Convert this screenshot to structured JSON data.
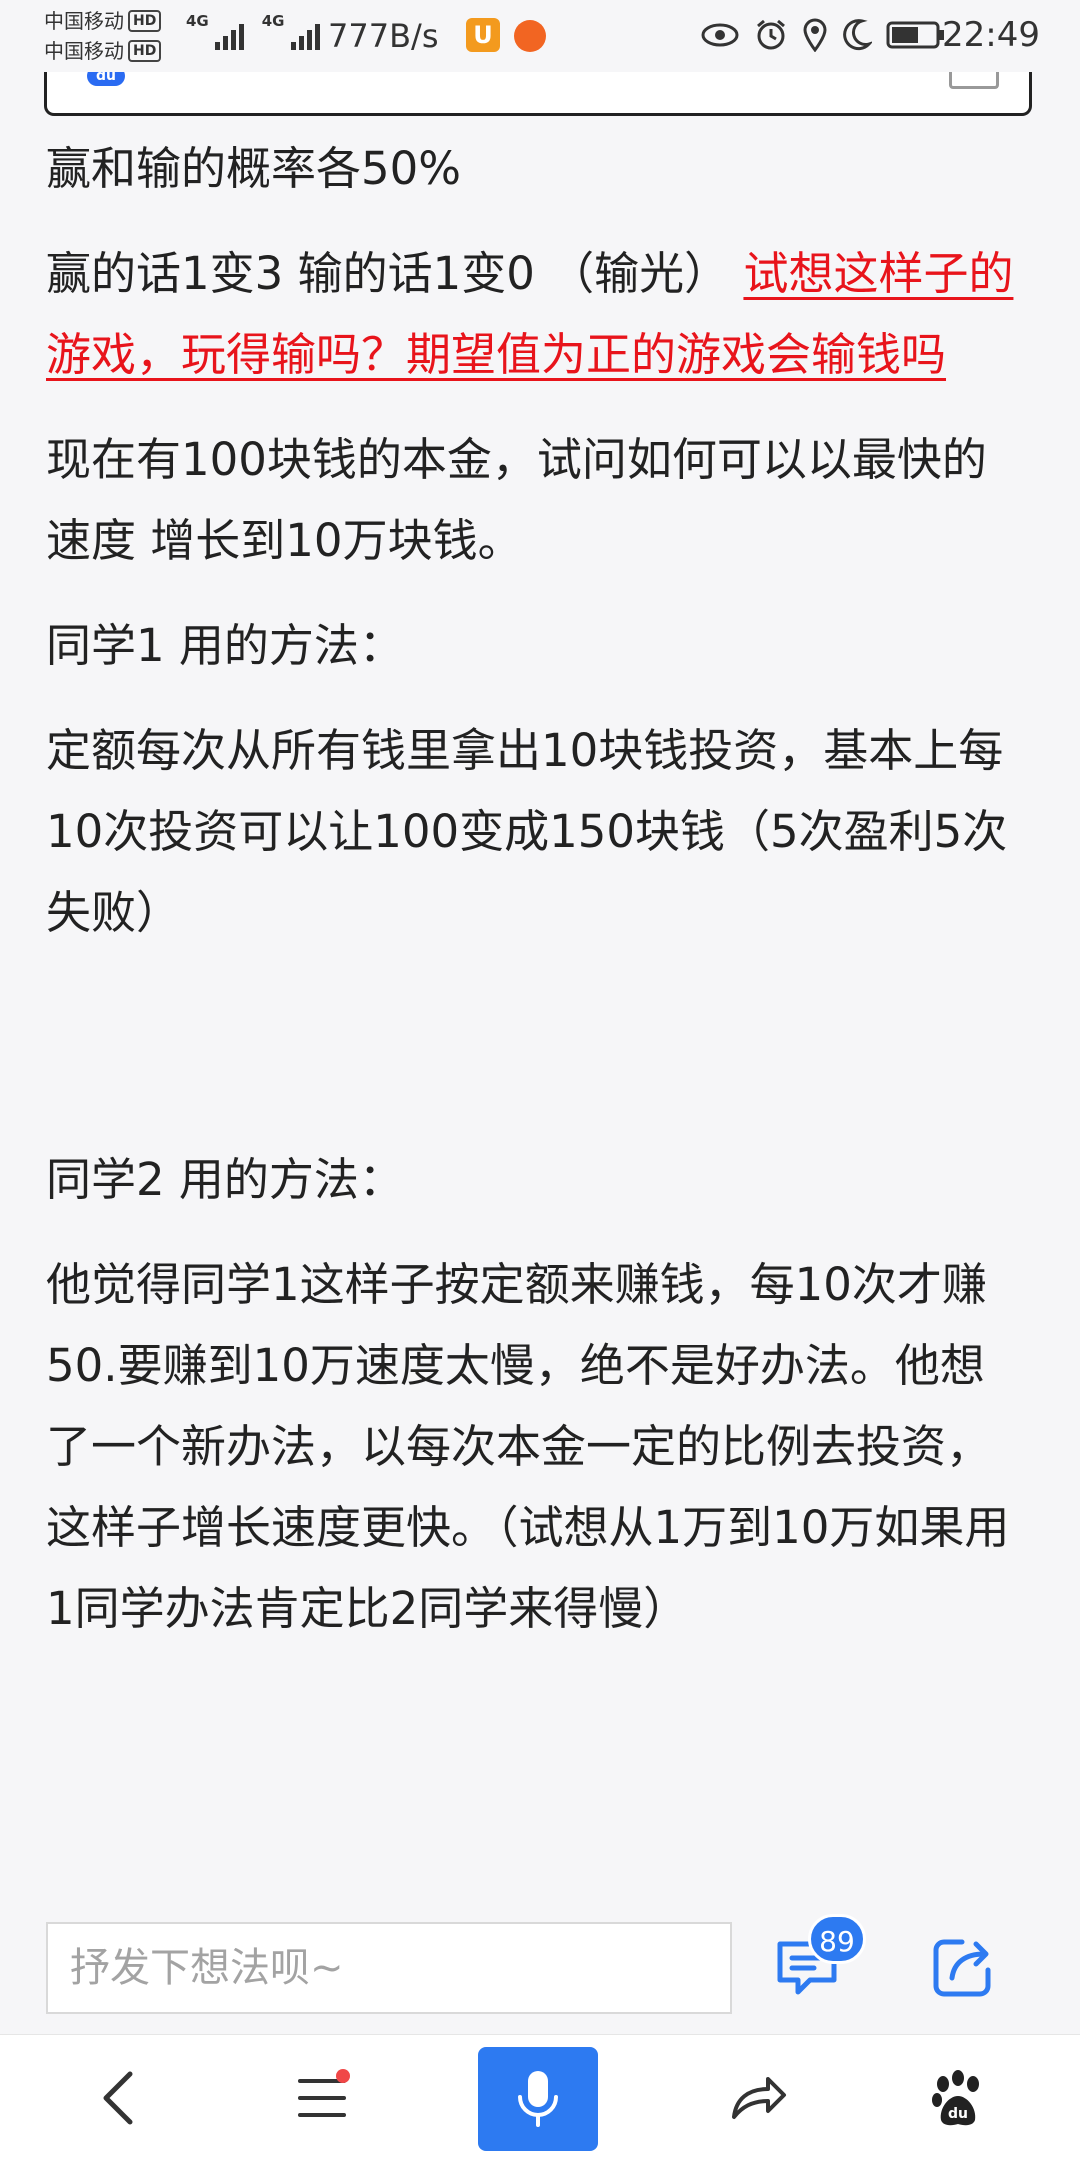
{
  "status_bar": {
    "carrier_1": "中国移动",
    "carrier_2": "中国移动",
    "hd_badge": "HD",
    "network_1": "4G",
    "network_2": "4G",
    "net_speed": "777B/s",
    "time": "22:49",
    "icons": [
      "eye-icon",
      "alarm-icon",
      "location-icon",
      "moon-icon",
      "battery-icon"
    ]
  },
  "search": {
    "logo_text": "du"
  },
  "article": {
    "p1": "赢和输的概率各50%",
    "p2_text": "赢的话1变3 输的话1变0 （输光） ",
    "p2_link": "试想这样子的游戏，玩得输吗？期望值为正的游戏会输钱吗",
    "p3": "现在有100块钱的本金，试问如何可以以最快的速度 增长到10万块钱。",
    "p4": "同学1 用的方法：",
    "p5": "定额每次从所有钱里拿出10块钱投资，基本上每10次投资可以让100变成150块钱（5次盈利5次失败）",
    "p6": "同学2 用的方法：",
    "p7": "他觉得同学1这样子按定额来赚钱，每10次才赚50.要赚到10万速度太慢，绝不是好办法。他想了一个新办法，以每次本金一定的比例去投资，这样子增长速度更快。（试想从1万到10万如果用1同学办法肯定比2同学来得慢）"
  },
  "comment_bar": {
    "placeholder": "抒发下想法呗~",
    "comment_count": "89"
  },
  "colors": {
    "accent": "#2d7af1",
    "link_red": "#e8141b",
    "background": "#f6f6f8"
  }
}
